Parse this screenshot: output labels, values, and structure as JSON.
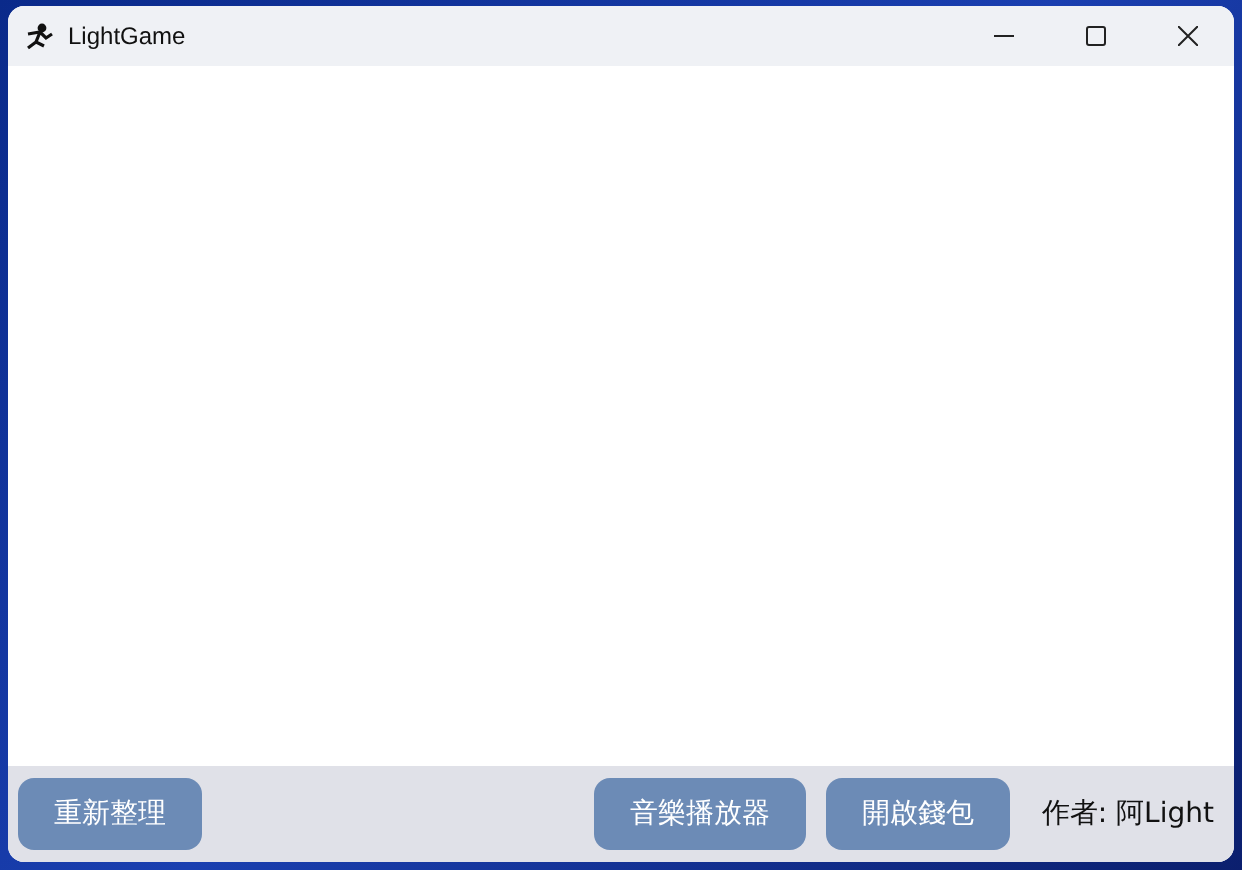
{
  "window": {
    "title": "LightGame"
  },
  "footer": {
    "buttons_left": [
      {
        "label": "重新整理"
      }
    ],
    "buttons_right": [
      {
        "label": "音樂播放器"
      },
      {
        "label": "開啟錢包"
      }
    ],
    "author": "作者: 阿Light"
  }
}
